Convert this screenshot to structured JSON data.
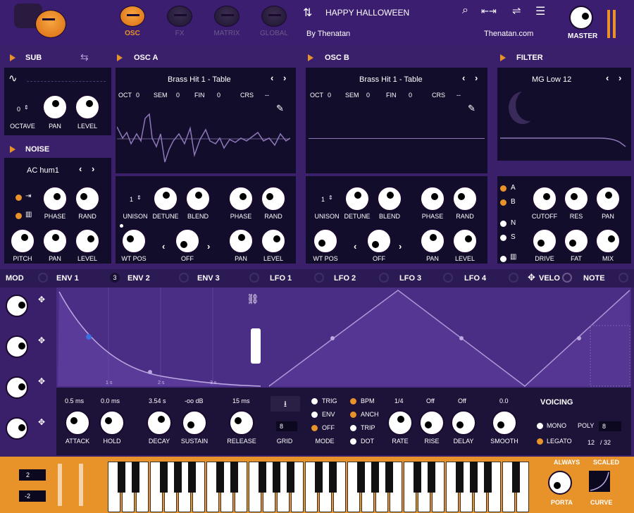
{
  "preset": {
    "name": "HAPPY HALLOWEEN",
    "author": "By Thenatan",
    "site": "Thenatan.com"
  },
  "tabs": [
    {
      "label": "OSC"
    },
    {
      "label": "FX"
    },
    {
      "label": "MATRIX"
    },
    {
      "label": "GLOBAL"
    }
  ],
  "master_label": "MASTER",
  "sub": {
    "title": "SUB",
    "octave_value": "0",
    "octave_label": "OCTAVE",
    "pan": "PAN",
    "level": "LEVEL"
  },
  "noise": {
    "title": "NOISE",
    "preset": "AC hum1",
    "phase": "PHASE",
    "rand": "RAND",
    "pitch": "PITCH",
    "pan": "PAN",
    "level": "LEVEL"
  },
  "osc_a": {
    "title": "OSC A",
    "table": "Brass Hit 1 - Table",
    "oct_label": "OCT",
    "oct": "0",
    "sem_label": "SEM",
    "sem": "0",
    "fin_label": "FIN",
    "fin": "0",
    "crs_label": "CRS",
    "crs": "--",
    "unison_value": "1",
    "unison": "UNISON",
    "detune": "DETUNE",
    "blend": "BLEND",
    "phase": "PHASE",
    "rand": "RAND",
    "wtpos": "WT POS",
    "off": "OFF",
    "pan": "PAN",
    "level": "LEVEL"
  },
  "osc_b": {
    "title": "OSC B",
    "table": "Brass Hit 1 - Table",
    "oct_label": "OCT",
    "oct": "0",
    "sem_label": "SEM",
    "sem": "0",
    "fin_label": "FIN",
    "fin": "0",
    "crs_label": "CRS",
    "crs": "--",
    "unison_value": "1",
    "unison": "UNISON",
    "detune": "DETUNE",
    "blend": "BLEND",
    "phase": "PHASE",
    "rand": "RAND",
    "wtpos": "WT POS",
    "off": "OFF",
    "pan": "PAN",
    "level": "LEVEL"
  },
  "filter": {
    "title": "FILTER",
    "type": "MG Low 12",
    "a": "A",
    "b": "B",
    "n": "N",
    "s": "S",
    "cutoff": "CUTOFF",
    "res": "RES",
    "pan": "PAN",
    "drive": "DRIVE",
    "fat": "FAT",
    "mix": "MIX"
  },
  "mod_tabs": {
    "mod": "MOD",
    "env1": "ENV 1",
    "env1_count": "3",
    "env2": "ENV 2",
    "env3": "ENV 3",
    "lfo1": "LFO 1",
    "lfo2": "LFO 2",
    "lfo3": "LFO 3",
    "lfo4": "LFO 4",
    "velo": "VELO",
    "note": "NOTE"
  },
  "env_graph": {
    "ticks": [
      "1 s",
      "2 s",
      "3 s"
    ]
  },
  "env": {
    "attack_val": "0.5 ms",
    "hold_val": "0.0 ms",
    "decay_val": "3.54 s",
    "sustain_val": "-oo dB",
    "release_val": "15 ms",
    "attack": "ATTACK",
    "hold": "HOLD",
    "decay": "DECAY",
    "sustain": "SUSTAIN",
    "release": "RELEASE"
  },
  "lfo": {
    "grid": "GRID",
    "grid_val": "8",
    "mode": "MODE",
    "trig": "TRIG",
    "env": "ENV",
    "off": "OFF",
    "bpm": "BPM",
    "anch": "ANCH",
    "trip": "TRIP",
    "dot": "DOT",
    "rate_val": "1/4",
    "rise_val": "Off",
    "delay_val": "Off",
    "smooth_val": "0.0",
    "rate": "RATE",
    "rise": "RISE",
    "delay": "DELAY",
    "smooth": "SMOOTH"
  },
  "voicing": {
    "title": "VOICING",
    "mono": "MONO",
    "poly": "POLY",
    "poly_val": "8",
    "legato": "LEGATO",
    "voices": "12",
    "voices_max": "/ 32"
  },
  "keyboard": {
    "pitch_up": "2",
    "pitch_down": "-2",
    "always": "ALWAYS",
    "scaled": "SCALED",
    "porta": "PORTA",
    "curve": "CURVE"
  },
  "colors": {
    "accent": "#e8922a",
    "bg": "#3a1f6b",
    "panel": "#130d2c"
  }
}
